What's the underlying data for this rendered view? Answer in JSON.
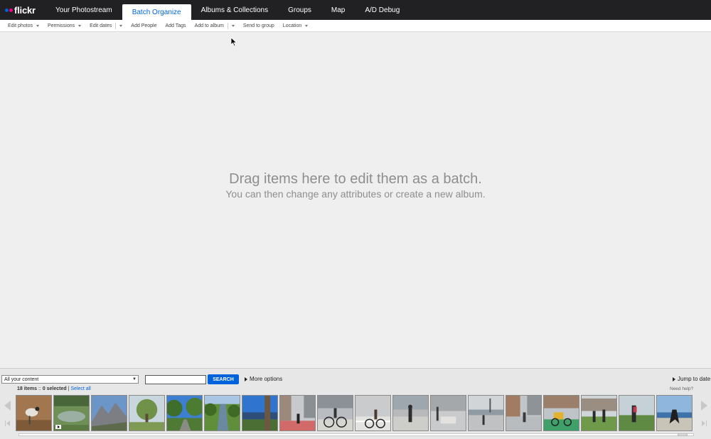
{
  "brand": {
    "logo_text": "flickr",
    "blue": "#0063dc",
    "pink": "#ff0084"
  },
  "nav": {
    "tabs": [
      {
        "label": "Your Photostream",
        "active": false
      },
      {
        "label": "Batch Organize",
        "active": true
      },
      {
        "label": "Albums & Collections",
        "active": false
      },
      {
        "label": "Groups",
        "active": false
      },
      {
        "label": "Map",
        "active": false
      },
      {
        "label": "A/D Debug",
        "active": false
      }
    ]
  },
  "toolbar": {
    "edit_photos": "Edit photos",
    "permissions": "Permissions",
    "edit_dates": "Edit dates",
    "add_people": "Add People",
    "add_tags": "Add Tags",
    "add_to_album": "Add to album",
    "send_to_group": "Send to group",
    "location": "Location"
  },
  "drop_zone": {
    "line1": "Drag items here to edit them as a batch.",
    "line2": "You can then change any attributes or create a new album."
  },
  "filmstrip": {
    "content_select_value": "All your content",
    "search_placeholder": "",
    "search_button": "SEARCH",
    "more_options": "More options",
    "jump_to_date": "Jump to date",
    "items_count": "18 items",
    "selected_text": "0 selected",
    "separator_text": " :: ",
    "pipe": " | ",
    "select_all": "Select all",
    "need_help": "Need help?",
    "thumbnails": [
      {
        "icon": "bird-photo-icon"
      },
      {
        "icon": "pond-video-icon",
        "video": true
      },
      {
        "icon": "mountain-photo-icon"
      },
      {
        "icon": "tree-photo-icon"
      },
      {
        "icon": "path-trees-photo-icon"
      },
      {
        "icon": "river-photo-icon"
      },
      {
        "icon": "lake-trunk-photo-icon"
      },
      {
        "icon": "street-photo-icon"
      },
      {
        "icon": "cyclist-photo-icon"
      },
      {
        "icon": "cyclist-photo-icon"
      },
      {
        "icon": "pedestrian-photo-icon"
      },
      {
        "icon": "plaza-photo-icon"
      },
      {
        "icon": "waterfront-photo-icon"
      },
      {
        "icon": "street-photo-icon"
      },
      {
        "icon": "cargo-bike-photo-icon"
      },
      {
        "icon": "park-walkers-photo-icon"
      },
      {
        "icon": "park-walkers-photo-icon"
      },
      {
        "icon": "runner-beach-photo-icon"
      }
    ]
  }
}
